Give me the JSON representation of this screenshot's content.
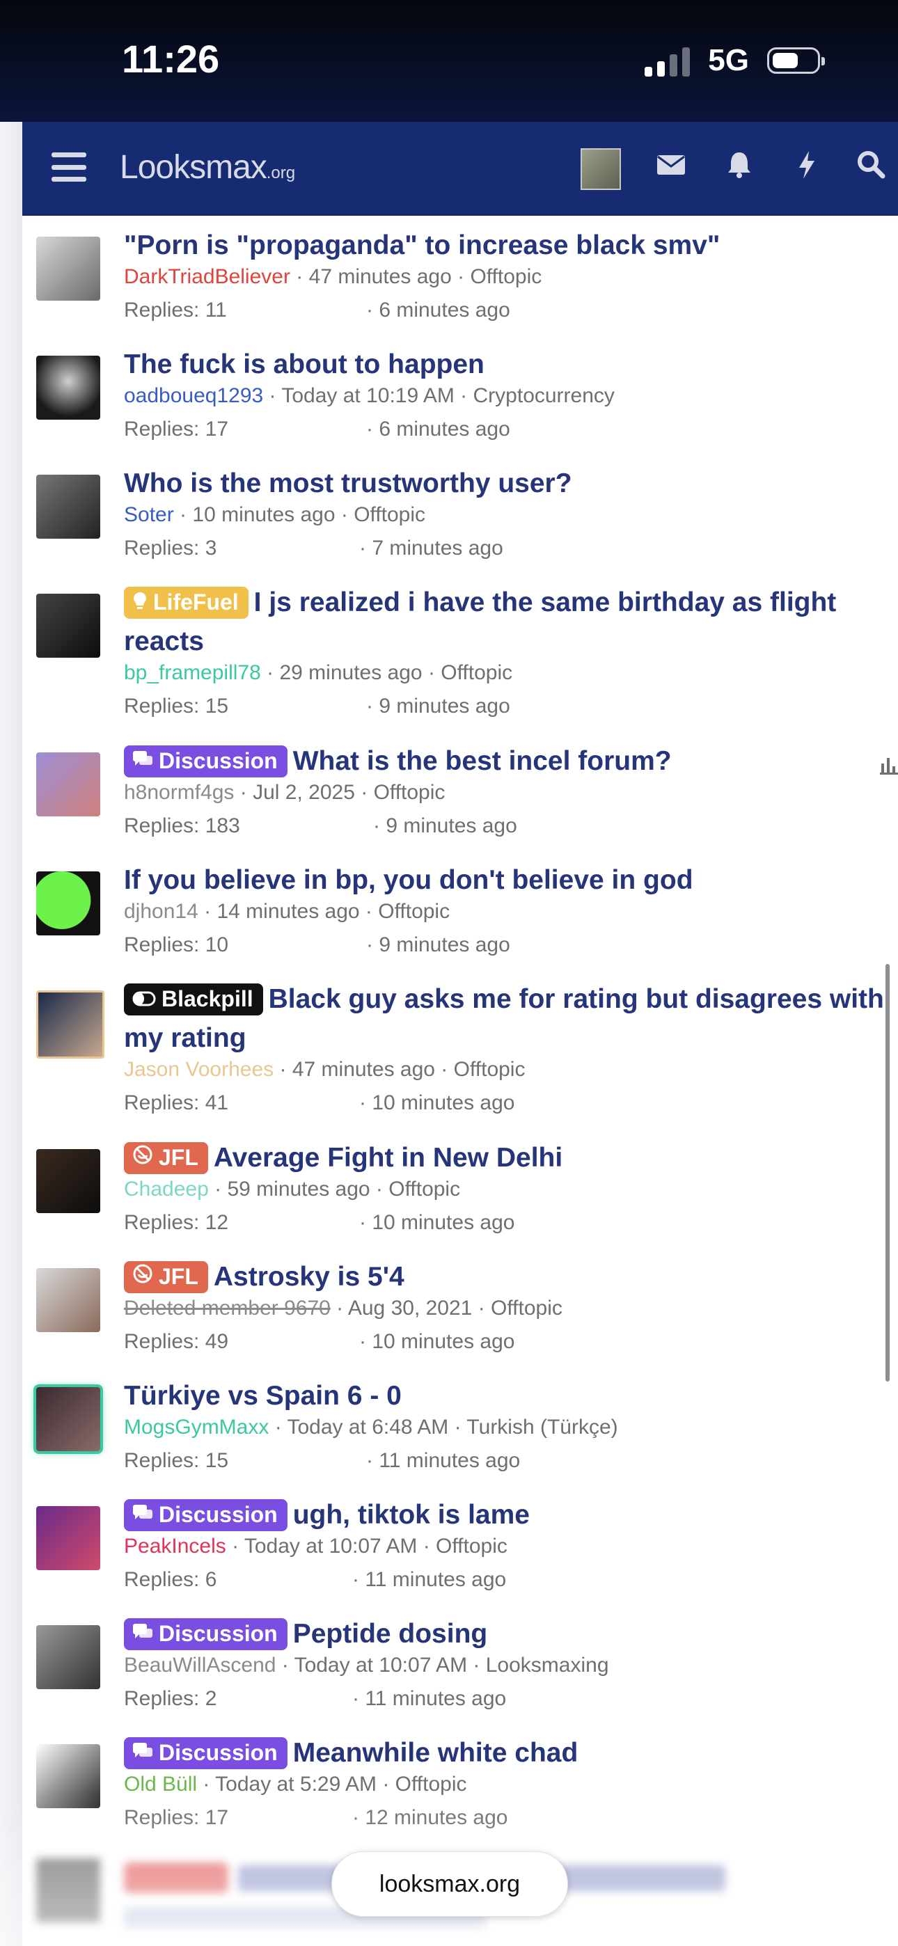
{
  "status_bar": {
    "time": "11:26",
    "network": "5G"
  },
  "header": {
    "logo": "Looksmax",
    "logo_suffix": ".org",
    "icons": [
      "avatar-thumbnail",
      "mail-icon",
      "bell-icon",
      "bolt-icon",
      "search-icon"
    ]
  },
  "threads": [
    {
      "prefix": "",
      "title": "\"Porn is \"propaganda\" to increase black smv\"",
      "user": "DarkTriadBeliever",
      "user_color": "#e0443a",
      "posted": "47 minutes ago",
      "forum": "Offtopic",
      "replies": "Replies: 11",
      "last": "· 6 minutes ago"
    },
    {
      "prefix": "",
      "title": "The fuck is about to happen",
      "user": "oadboueq1293",
      "user_color": "#3a5cc2",
      "posted": "Today at 10:19 AM",
      "forum": "Cryptocurrency",
      "replies": "Replies: 17",
      "last": "· 6 minutes ago"
    },
    {
      "prefix": "",
      "title": "Who is the most trustworthy user?",
      "user": "Soter",
      "user_color": "#3a5cc2",
      "posted": "10 minutes ago",
      "forum": "Offtopic",
      "replies": "Replies: 3",
      "last": "· 7 minutes ago"
    },
    {
      "prefix": "LifeFuel",
      "prefix_color": "#f0c04a",
      "title": "I js realized i have the same birthday as flight reacts",
      "user": "bp_framepill78",
      "user_color": "#3cc8a0",
      "posted": "29 minutes ago",
      "forum": "Offtopic",
      "replies": "Replies: 15",
      "last": "· 9 minutes ago"
    },
    {
      "prefix": "Discussion",
      "prefix_color": "#7a4ee0",
      "title": "What is the best incel forum?",
      "user": "h8normf4gs",
      "user_color": "#8a8a8a",
      "posted": "Jul 2, 2025",
      "forum": "Offtopic",
      "replies": "Replies: 183",
      "last": "· 9 minutes ago"
    },
    {
      "prefix": "",
      "title": "If you believe in bp, you don't believe in god",
      "user": "djhon14",
      "user_color": "#8a8a8a",
      "posted": "14 minutes ago",
      "forum": "Offtopic",
      "replies": "Replies: 10",
      "last": "· 9 minutes ago"
    },
    {
      "prefix": "Blackpill",
      "prefix_color": "#111111",
      "title": "Black guy asks me for rating but disagrees with my rating",
      "user": "Jason Voorhees",
      "user_color": "#e8c890",
      "posted": "47 minutes ago",
      "forum": "Offtopic",
      "replies": "Replies: 41",
      "last": "· 10 minutes ago"
    },
    {
      "prefix": "JFL",
      "prefix_color": "#e0684e",
      "title": "Average Fight in New Delhi",
      "user": "Chadeep",
      "user_color": "#7ad8c4",
      "posted": "59 minutes ago",
      "forum": "Offtopic",
      "replies": "Replies: 12",
      "last": "· 10 minutes ago"
    },
    {
      "prefix": "JFL",
      "prefix_color": "#e0684e",
      "title": "Astrosky is 5'4",
      "user": "Deleted member 9670",
      "user_color": "#8a8a8a",
      "posted": "Aug 30, 2021",
      "forum": "Offtopic",
      "replies": "Replies: 49",
      "last": "· 10 minutes ago"
    },
    {
      "prefix": "",
      "title": "Türkiye vs Spain 6 - 0",
      "user": "MogsGymMaxx",
      "user_color": "#3cc8a0",
      "posted": "Today at 6:48 AM",
      "forum": "Turkish (Türkçe)",
      "replies": "Replies: 15",
      "last": "· 11 minutes ago"
    },
    {
      "prefix": "Discussion",
      "prefix_color": "#7a4ee0",
      "title": "ugh, tiktok is lame",
      "user": "PeakIncels",
      "user_color": "#e0345a",
      "posted": "Today at 10:07 AM",
      "forum": "Offtopic",
      "replies": "Replies: 6",
      "last": "· 11 minutes ago"
    },
    {
      "prefix": "Discussion",
      "prefix_color": "#7a4ee0",
      "title": "Peptide dosing",
      "user": "BeauWillAscend",
      "user_color": "#8a8a8a",
      "posted": "Today at 10:07 AM",
      "forum": "Looksmaxing",
      "replies": "Replies: 2",
      "last": "· 11 minutes ago"
    },
    {
      "prefix": "Discussion",
      "prefix_color": "#7a4ee0",
      "title": "Meanwhile white chad",
      "user": "Old Büll",
      "user_color": "#6ab84a",
      "posted": "Today at 5:29 AM",
      "forum": "Offtopic",
      "replies": "Replies: 17",
      "last": "· 12 minutes ago"
    }
  ],
  "url_bar": "looksmax.org"
}
